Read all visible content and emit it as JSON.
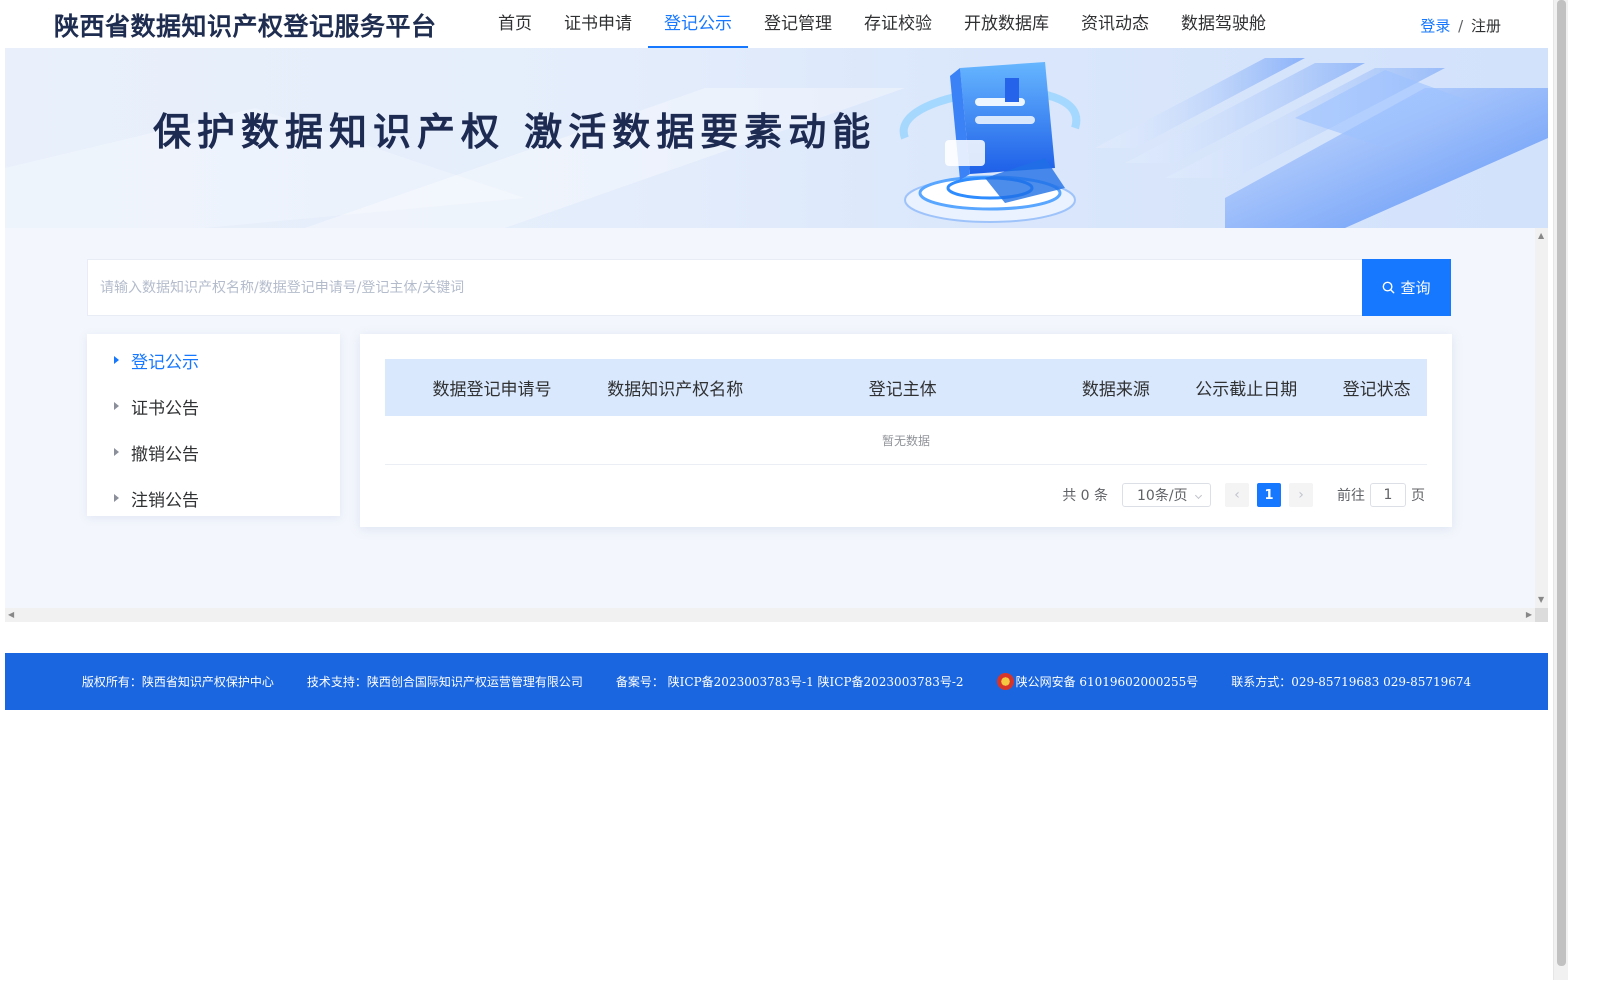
{
  "header": {
    "site_title": "陕西省数据知识产权登记服务平台",
    "nav": [
      {
        "label": "首页",
        "active": false
      },
      {
        "label": "证书申请",
        "active": false
      },
      {
        "label": "登记公示",
        "active": true
      },
      {
        "label": "登记管理",
        "active": false
      },
      {
        "label": "存证校验",
        "active": false
      },
      {
        "label": "开放数据库",
        "active": false
      },
      {
        "label": "资讯动态",
        "active": false
      },
      {
        "label": "数据驾驶舱",
        "active": false
      }
    ],
    "login_label": "登录",
    "separator": "/",
    "register_label": "注册"
  },
  "banner": {
    "slogan": "保护数据知识产权 激活数据要素动能"
  },
  "search": {
    "placeholder": "请输入数据知识产权名称/数据登记申请号/登记主体/关键词",
    "value": "",
    "button_label": "查询",
    "button_icon": "search-icon"
  },
  "sidebar": {
    "items": [
      {
        "label": "登记公示",
        "active": true
      },
      {
        "label": "证书公告",
        "active": false
      },
      {
        "label": "撤销公告",
        "active": false
      },
      {
        "label": "注销公告",
        "active": false
      }
    ]
  },
  "table": {
    "columns": [
      "数据登记申请号",
      "数据知识产权名称",
      "登记主体",
      "数据来源",
      "公示截止日期",
      "登记状态"
    ],
    "rows": [],
    "empty_text": "暂无数据"
  },
  "pagination": {
    "total_text": "共 0 条",
    "page_size": "10条/页",
    "current_page": "1",
    "goto_label": "前往",
    "goto_value": "1",
    "page_unit": "页"
  },
  "footer": {
    "copyright": "版权所有：陕西省知识产权保护中心",
    "tech_support": "技术支持：陕西创合国际知识产权运营管理有限公司",
    "icp": "备案号： 陕ICP备2023003783号-1 陕ICP备2023003783号-2",
    "police": "陕公网安备 61019602000255号",
    "contact": "联系方式：029-85719683 029-85719674"
  },
  "colors": {
    "primary": "#1677ff",
    "footer_bg": "#1a66e0",
    "table_header_bg": "#d9e8fc",
    "main_bg": "#f3f6fc"
  }
}
